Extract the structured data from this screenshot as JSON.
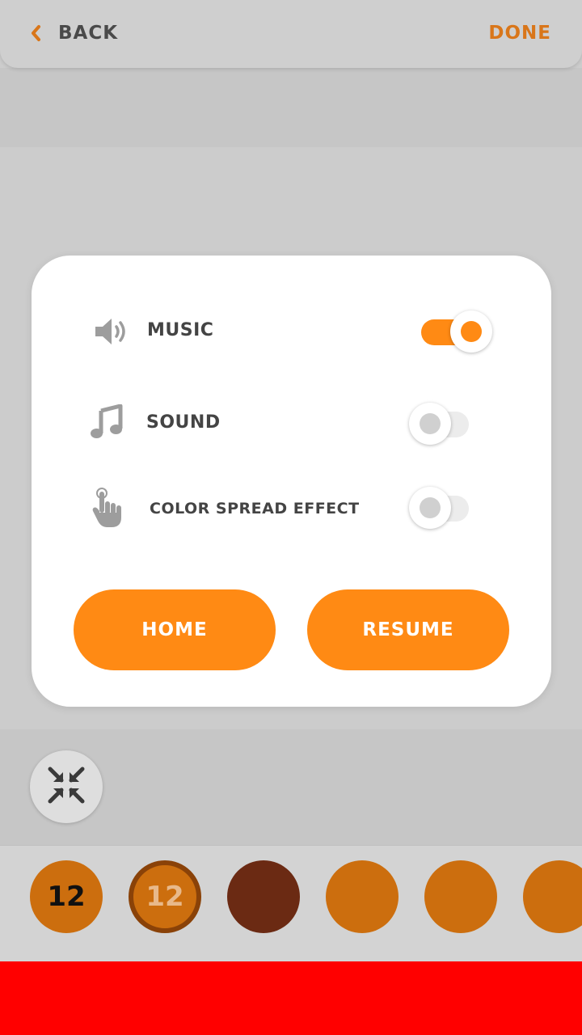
{
  "topbar": {
    "back_label": "BACK",
    "done_label": "DONE"
  },
  "settings": {
    "music": {
      "label": "MUSIC",
      "enabled": true
    },
    "sound": {
      "label": "SOUND",
      "enabled": false
    },
    "color_spread": {
      "label": "COLOR SPREAD EFFECT",
      "enabled": false
    }
  },
  "actions": {
    "home_label": "HOME",
    "resume_label": "RESUME"
  },
  "palette": {
    "swatches": [
      {
        "number": "12",
        "color": "#cc6e0e",
        "text_color": "#111111",
        "selected": false
      },
      {
        "number": "12",
        "color": "#cc6e0e",
        "text_color": "#e8b98a",
        "selected": true
      },
      {
        "number": "",
        "color": "#6b2a13",
        "selected": false
      },
      {
        "number": "",
        "color": "#cc6e0e",
        "selected": false
      },
      {
        "number": "",
        "color": "#cc6e0e",
        "selected": false
      },
      {
        "number": "",
        "color": "#cc6e0e",
        "selected": false
      }
    ]
  },
  "colors": {
    "accent": "#ff8a14",
    "link_orange": "#d9761a",
    "ad_banner": "#ff0000"
  }
}
